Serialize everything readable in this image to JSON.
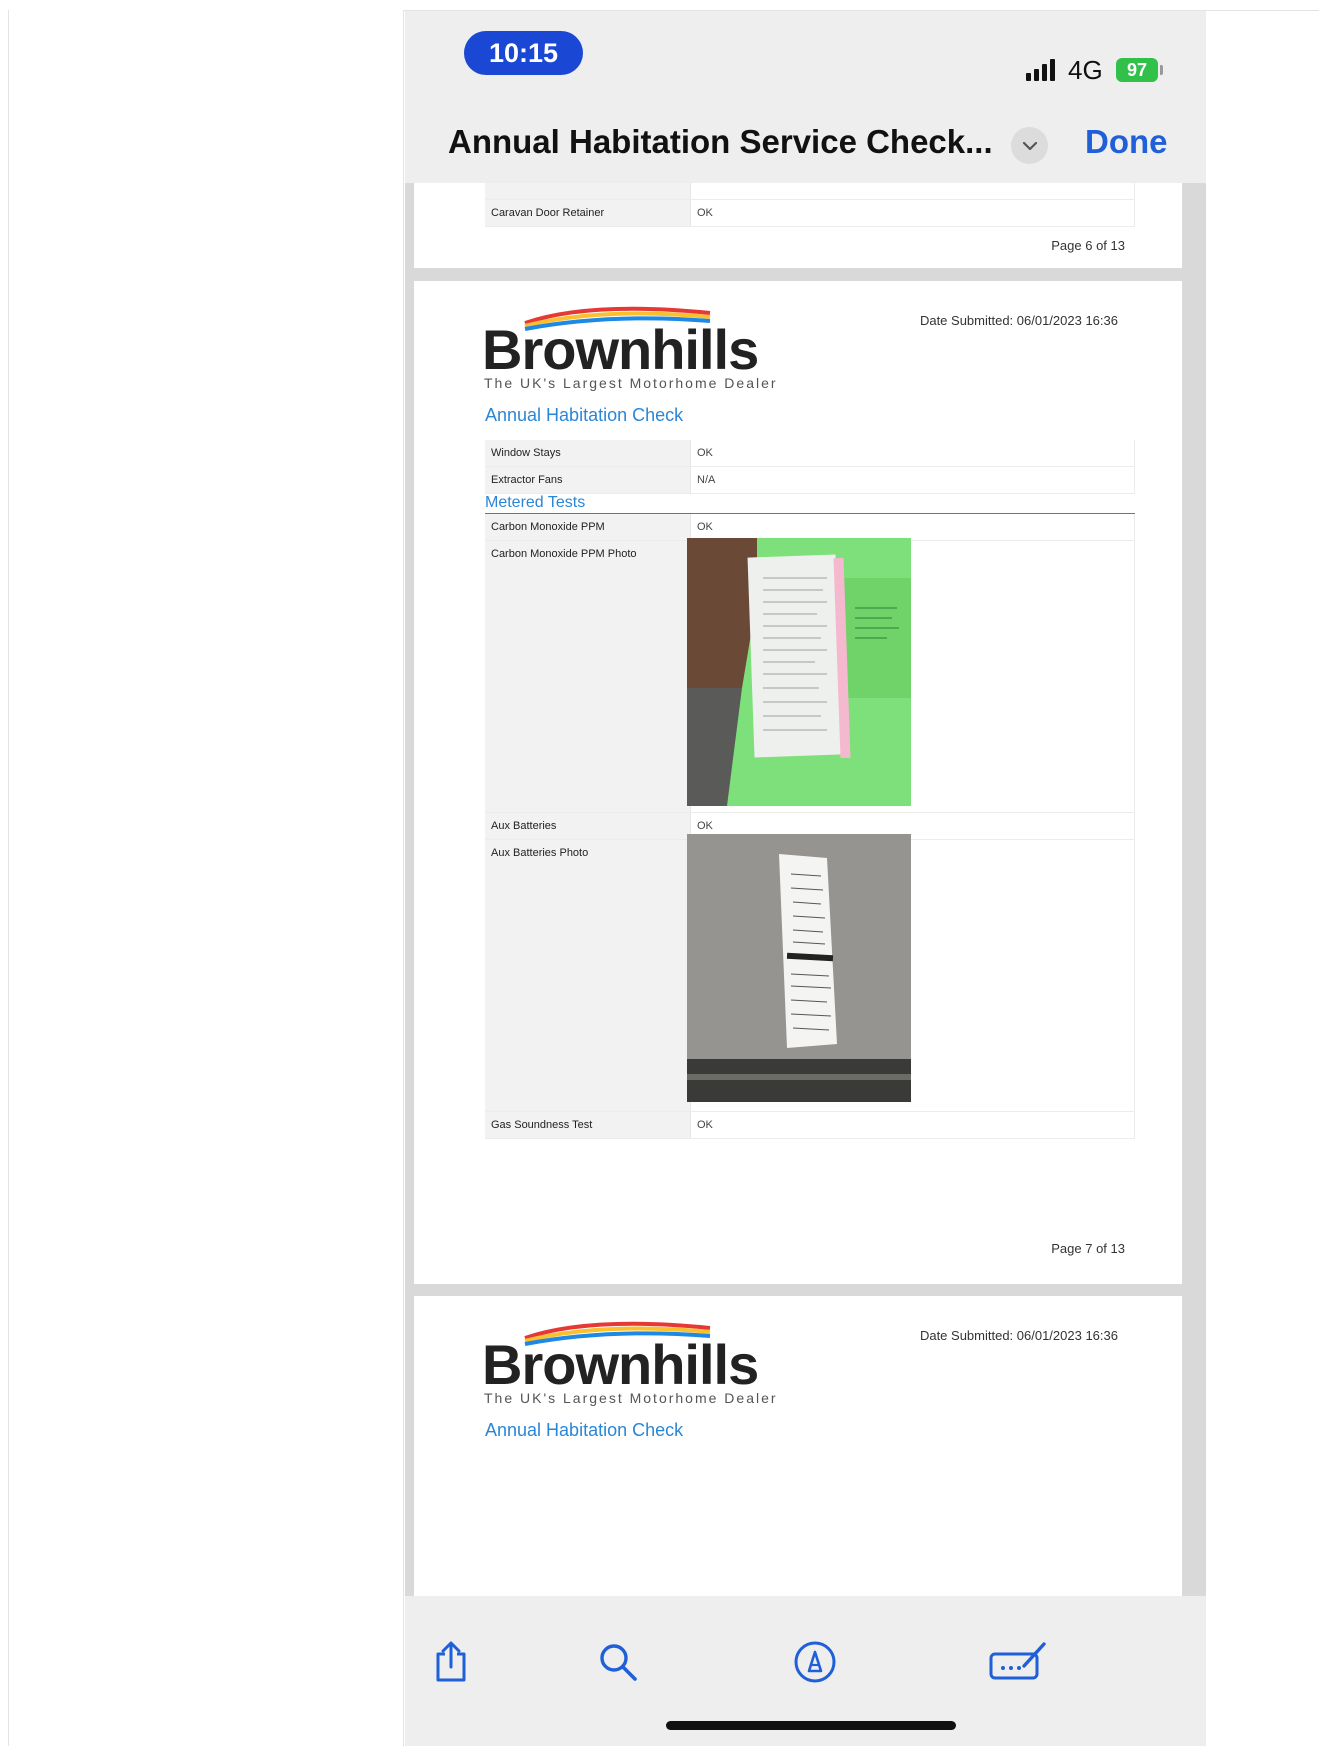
{
  "status_bar": {
    "time": "10:15",
    "network": "4G",
    "battery": "97"
  },
  "nav": {
    "title": "Annual Habitation Service Check...",
    "done_label": "Done"
  },
  "page6": {
    "rows": [
      {
        "label": "Caravan Door Retainer",
        "value": "OK"
      }
    ],
    "page_number": "Page 6 of 13"
  },
  "page7": {
    "date_submitted": "Date Submitted: 06/01/2023 16:36",
    "logo_text": "Brownhills",
    "logo_tagline": "The UK's Largest Motorhome Dealer",
    "section_title": "Annual Habitation Check",
    "rows_top": [
      {
        "label": "Window Stays",
        "value": "OK"
      },
      {
        "label": "Extractor Fans",
        "value": "N/A"
      }
    ],
    "metered_title": "Metered Tests",
    "rows_metered": {
      "co_ppm": {
        "label": "Carbon Monoxide PPM",
        "value": "OK"
      },
      "co_photo": {
        "label": "Carbon Monoxide PPM Photo"
      },
      "aux": {
        "label": "Aux Batteries",
        "value": "OK"
      },
      "aux_photo": {
        "label": "Aux Batteries Photo"
      },
      "gas": {
        "label": "Gas Soundness Test",
        "value": "OK"
      }
    },
    "page_number": "Page 7 of 13"
  },
  "page8": {
    "date_submitted": "Date Submitted: 06/01/2023 16:36",
    "logo_text": "Brownhills",
    "logo_tagline": "The UK's Largest Motorhome Dealer",
    "section_title": "Annual Habitation Check"
  },
  "toolbar": {
    "icons": [
      "share-icon",
      "search-icon",
      "markup-icon",
      "signature-icon"
    ]
  },
  "colors": {
    "time_pill": "#1a47d4",
    "battery": "#31c14a",
    "link": "#1f5fd8",
    "section": "#2a86d6"
  }
}
